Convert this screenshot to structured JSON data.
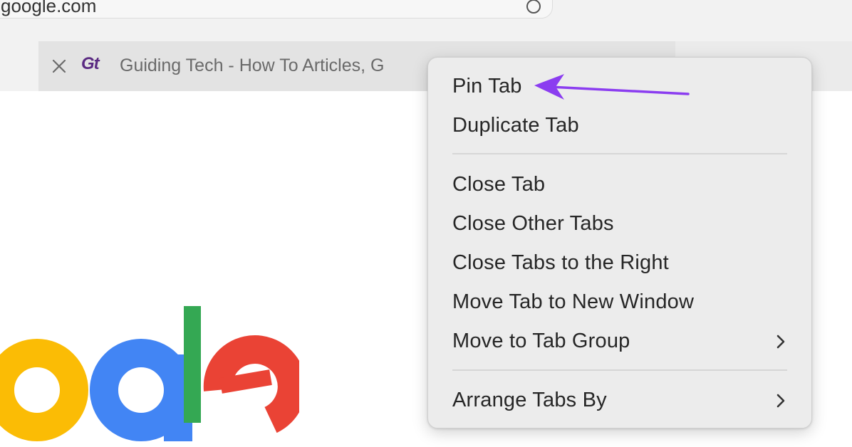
{
  "address_bar": {
    "url_text": "google.com"
  },
  "tab": {
    "favicon_text": "Gt",
    "title": "Guiding Tech - How To Articles, G"
  },
  "context_menu": {
    "items": [
      {
        "label": "Pin Tab",
        "has_submenu": false
      },
      {
        "label": "Duplicate Tab",
        "has_submenu": false
      },
      {
        "label": "Close Tab",
        "has_submenu": false
      },
      {
        "label": "Close Other Tabs",
        "has_submenu": false
      },
      {
        "label": "Close Tabs to the Right",
        "has_submenu": false
      },
      {
        "label": "Move Tab to New Window",
        "has_submenu": false
      },
      {
        "label": "Move to Tab Group",
        "has_submenu": true
      },
      {
        "label": "Arrange Tabs By",
        "has_submenu": true
      }
    ]
  },
  "annotation": {
    "color": "#8b3df0",
    "points_to": "Pin Tab"
  },
  "colors": {
    "google_yellow": "#fbbc05",
    "google_blue": "#4285f4",
    "google_green": "#34a853",
    "google_red": "#ea4335",
    "favicon": "#5a2a82"
  }
}
